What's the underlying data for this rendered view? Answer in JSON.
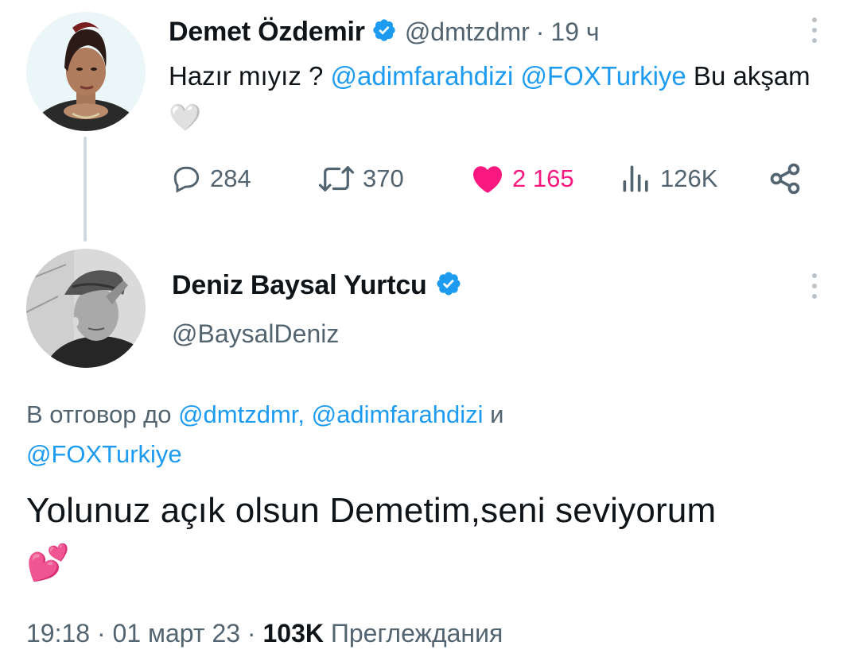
{
  "tweet1": {
    "name": "Demet Özdemir",
    "handle": "@dmtzdmr",
    "separator": "·",
    "time": "19 ч",
    "text_start": "Hazır mıyız ? ",
    "mention1": "@adimfarahdizi",
    "space": " ",
    "mention2": "@FOXTurkiye",
    "text_end": " Bu akşam",
    "emoji": "🤍",
    "actions": {
      "replies": "284",
      "retweets": "370",
      "likes": "2 165",
      "views": "126K"
    }
  },
  "tweet2": {
    "name": "Deniz Baysal Yurtcu",
    "handle": "@BaysalDeniz",
    "reply_prefix": "В отговор до ",
    "reply_mention1": "@dmtzdmr,",
    "reply_mention2": "@adimfarahdizi",
    "reply_and": " и ",
    "reply_mention3": "@FOXTurkiye",
    "text": "Yolunuz açık olsun Demetim,seni seviyorum",
    "emoji": "💕",
    "meta": {
      "time": "19:18",
      "dot": "·",
      "date": "01 март 23",
      "views_count": "103K",
      "views_label": "Преглеждания"
    }
  },
  "colors": {
    "link": "#1d9bf0",
    "like": "#f91880",
    "muted": "#536471",
    "text": "#0f1419",
    "verified": "#1d9bf0"
  }
}
